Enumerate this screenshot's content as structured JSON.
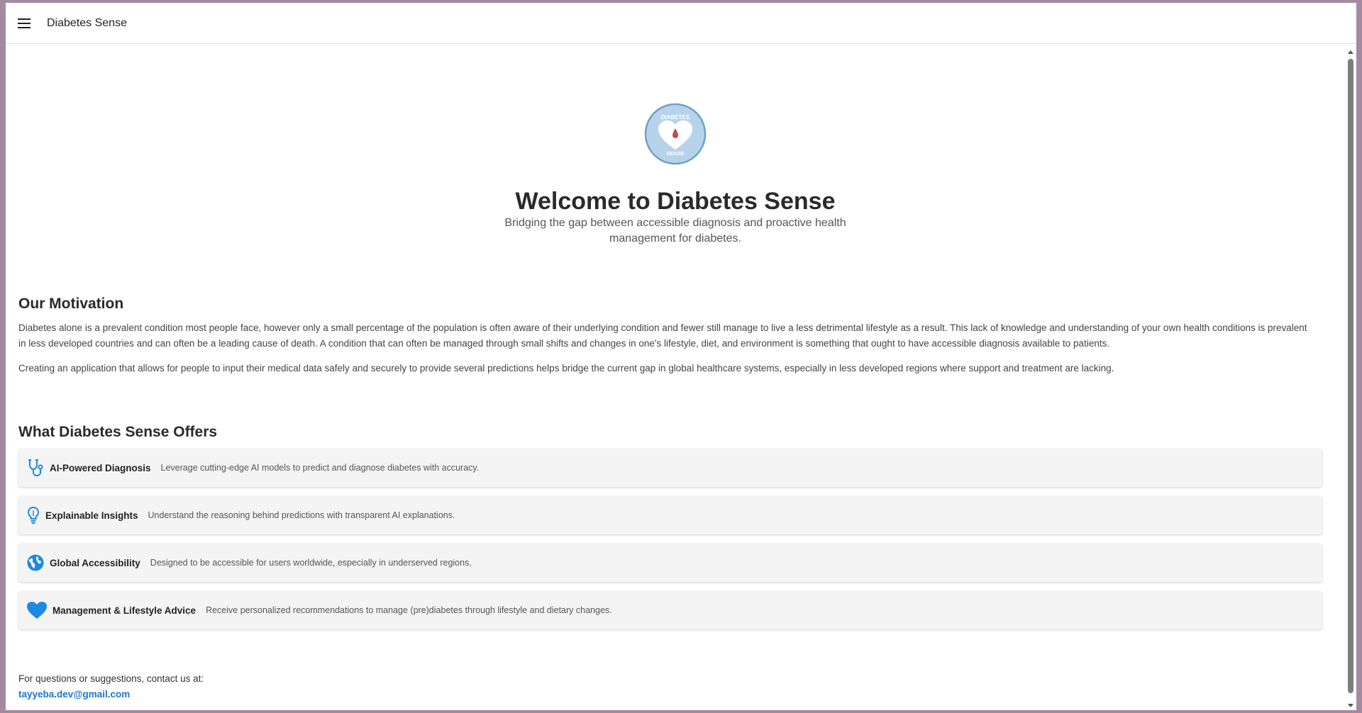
{
  "app": {
    "title": "Diabetes Sense"
  },
  "hero": {
    "logo_text_top": "DIABETES",
    "logo_text_bottom": "SENSE",
    "title": "Welcome to Diabetes Sense",
    "subtitle": "Bridging the gap between accessible diagnosis and proactive health management for diabetes."
  },
  "motivation": {
    "heading": "Our Motivation",
    "paragraph1": "Diabetes alone is a prevalent condition most people face, however only a small percentage of the population is often aware of their underlying condition and fewer still manage to live a less detrimental lifestyle as a result. This lack of knowledge and understanding of your own health conditions is prevalent in less developed countries and can often be a leading cause of death. A condition that can often be managed through small shifts and changes in one's lifestyle, diet, and environment is something that ought to have accessible diagnosis available to patients.",
    "paragraph2": "Creating an application that allows for people to input their medical data safely and securely to provide several predictions helps bridge the current gap in global healthcare systems, especially in less developed regions where support and treatment are lacking."
  },
  "offers": {
    "heading": "What Diabetes Sense Offers",
    "items": [
      {
        "icon": "stethoscope-icon",
        "title": "AI-Powered Diagnosis",
        "description": "Leverage cutting-edge AI models to predict and diagnose diabetes with accuracy."
      },
      {
        "icon": "lightbulb-icon",
        "title": "Explainable Insights",
        "description": "Understand the reasoning behind predictions with transparent AI explanations."
      },
      {
        "icon": "globe-icon",
        "title": "Global Accessibility",
        "description": "Designed to be accessible for users worldwide, especially in underserved regions."
      },
      {
        "icon": "heart-icon",
        "title": "Management & Lifestyle Advice",
        "description": "Receive personalized recommendations to manage (pre)diabetes through lifestyle and dietary changes."
      }
    ]
  },
  "contact": {
    "text": "For questions or suggestions, contact us at:",
    "email": "tayyeba.dev@gmail.com"
  },
  "colors": {
    "accent": "#1976d2",
    "icon_blue": "#1e88e5",
    "logo_bg": "#b7d3ea",
    "drop_red": "#c0504d"
  }
}
